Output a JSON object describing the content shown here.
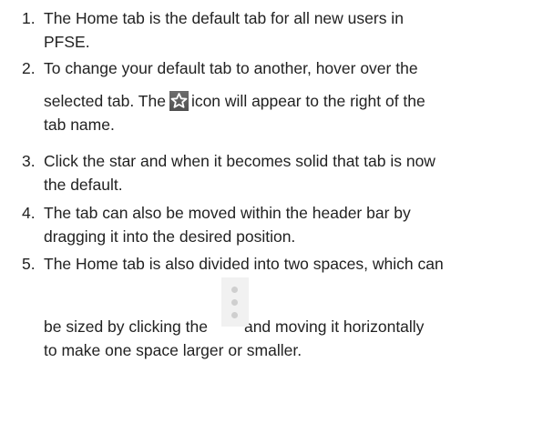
{
  "items": [
    {
      "number": "1.",
      "lines": [
        "The Home tab is the default tab for all new users in",
        "PFSE."
      ]
    },
    {
      "number": "2.",
      "lines": [
        "To change your default tab to another, hover over the"
      ],
      "line2_before": "selected tab. The",
      "line2_after": "icon will appear to the right of the",
      "line3": "tab name.",
      "icon": "star-icon"
    },
    {
      "number": "3.",
      "lines": [
        "Click the star and when it becomes solid that tab is now",
        "the default."
      ]
    },
    {
      "number": "4.",
      "lines": [
        "The tab can also be moved within the header bar by",
        "dragging it into the desired position."
      ]
    },
    {
      "number": "5.",
      "lines": [
        "The Home tab is also divided into two spaces, which can"
      ],
      "line2_before": "be sized by clicking the",
      "line2_after": "and moving it horizontally",
      "line3": "to make one space larger or smaller.",
      "icon": "vertical-dots-handle-icon"
    }
  ],
  "colors": {
    "text": "#222222",
    "star_icon_bg": "#5a5a5a",
    "handle_bg": "#f1f1f1",
    "handle_dots": "#cfcfcf"
  }
}
